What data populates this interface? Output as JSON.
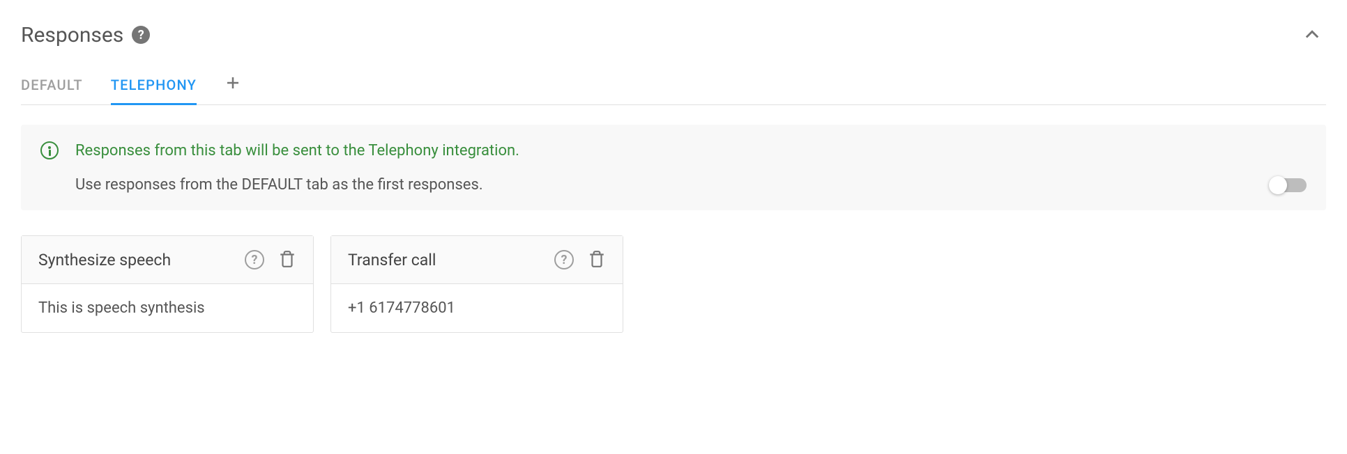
{
  "section": {
    "title": "Responses"
  },
  "tabs": {
    "default_label": "DEFAULT",
    "telephony_label": "TELEPHONY"
  },
  "info": {
    "primary": "Responses from this tab will be sent to the Telephony integration.",
    "secondary": "Use responses from the DEFAULT tab as the first responses."
  },
  "cards": [
    {
      "title": "Synthesize speech",
      "body": "This is speech synthesis"
    },
    {
      "title": "Transfer call",
      "body": "+1  6174778601"
    }
  ]
}
